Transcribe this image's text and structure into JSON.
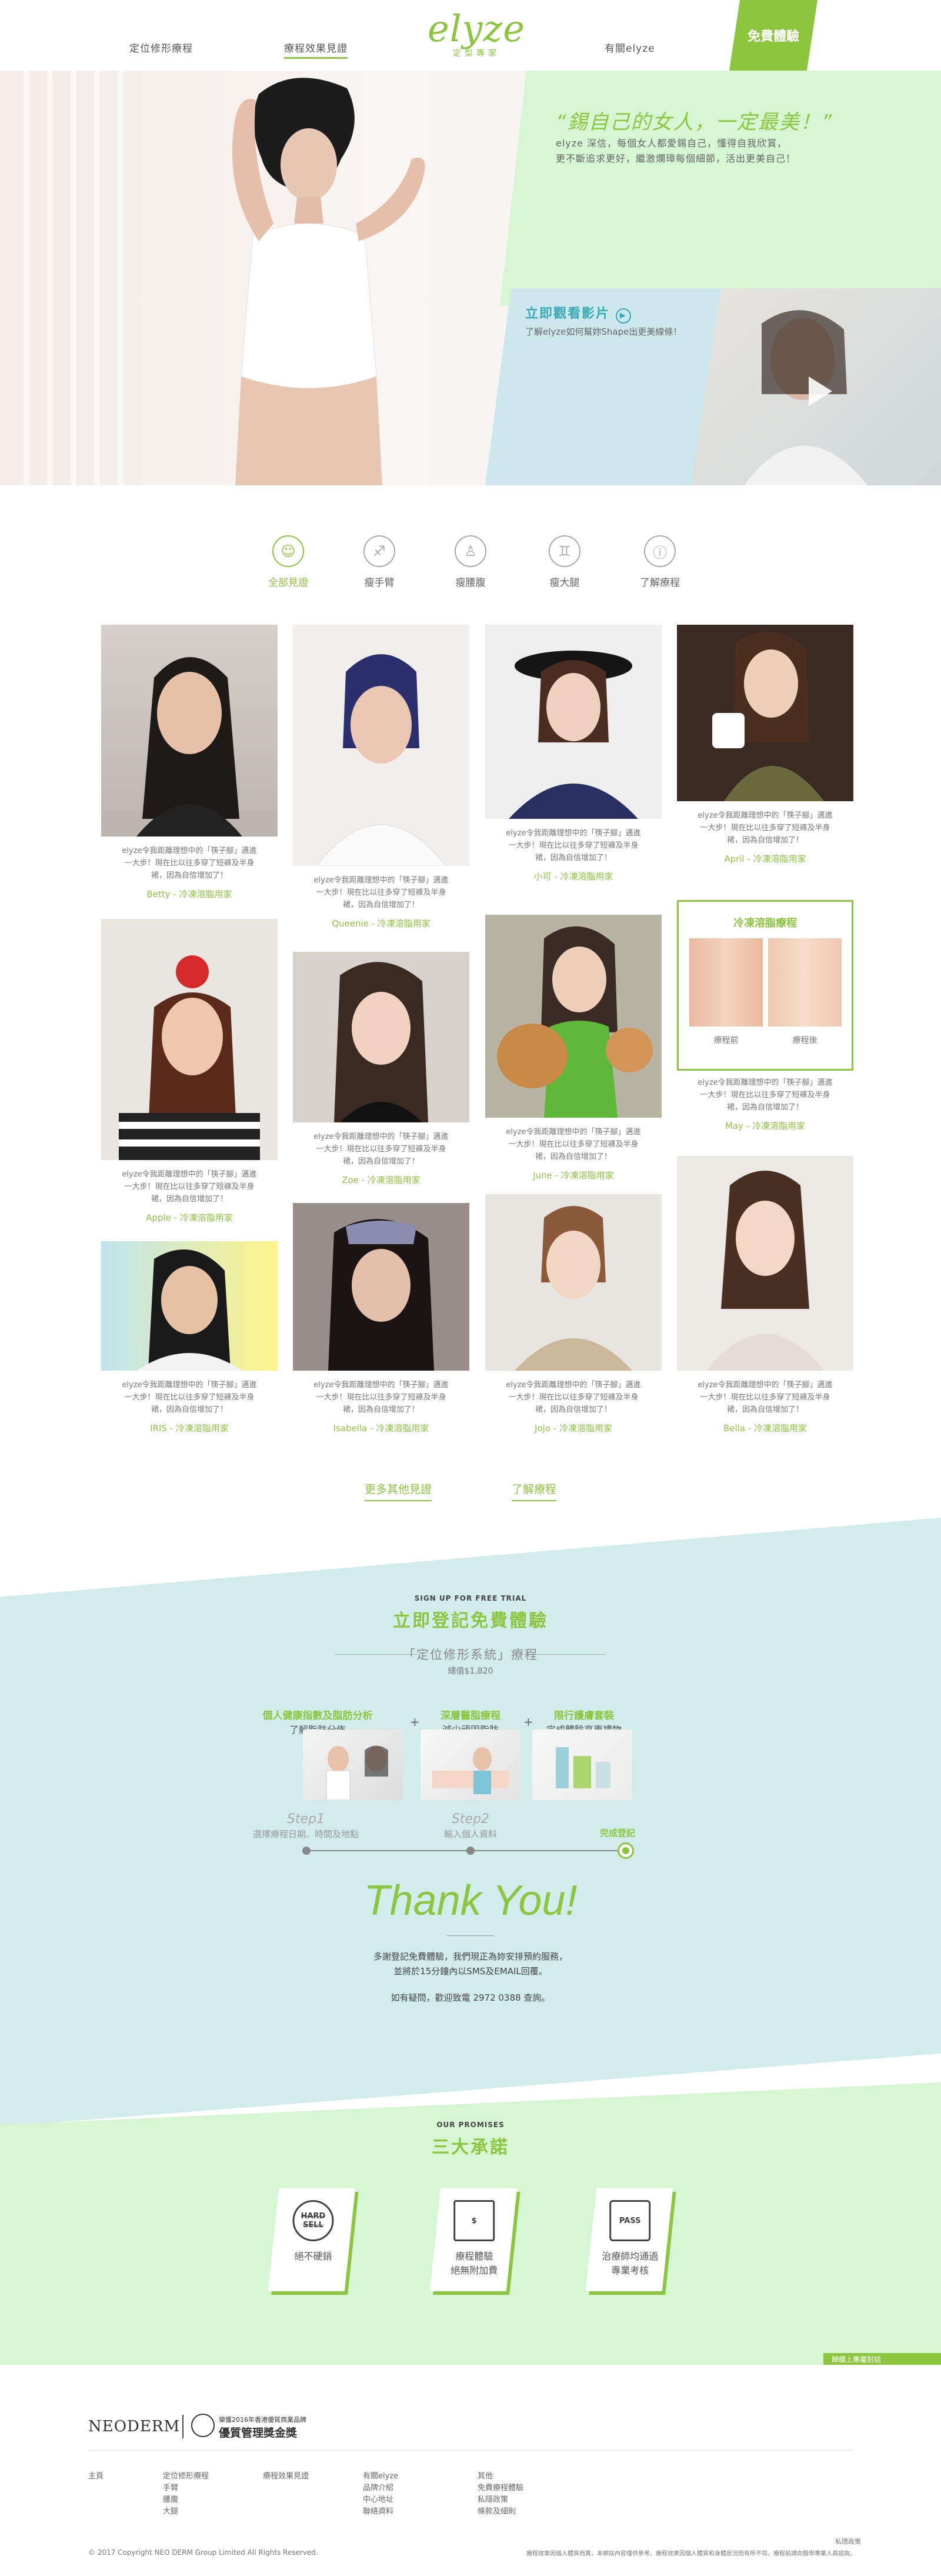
{
  "nav": {
    "left1": "定位修形療程",
    "left2": "療程效果見證",
    "right1": "有關elyze",
    "cta": "免費體驗"
  },
  "logo": {
    "word": "elyze",
    "sub": "定型專家"
  },
  "hero": {
    "quote": "“錫自己的女人，一定最美！”",
    "sub1": "elyze 深信，每個女人都愛錫自己，懂得自我欣賞，",
    "sub2": "更不斷追求更好，繼激爛璋每個細節，活出更美自己！",
    "video_title": "立即觀看影片",
    "video_sub": "了解elyze如何幫妳Shape出更美線條！"
  },
  "filters": [
    {
      "label": "全部見證",
      "icon": "body-icon"
    },
    {
      "label": "瘦手臂",
      "icon": "arm-icon"
    },
    {
      "label": "瘦腰腹",
      "icon": "waist-icon"
    },
    {
      "label": "瘦大腿",
      "icon": "thigh-icon"
    },
    {
      "label": "了解療程",
      "icon": "info-icon"
    }
  ],
  "cards": {
    "desc": "elyze令我距離理想中的「筷子腳」邁進一大步！現在比以往多穿了短褲及半身裙，因為自信增加了！",
    "betty": "Betty - 冷凍溶脂用家",
    "queenie": "Queenie - 冷凍溶脂用家",
    "xiaoke": "小可 - 冷凍溶脂用家",
    "april": "April - 冷凍溶脂用家",
    "apple": "Apple - 冷凍溶脂用家",
    "zoe": "Zoe - 冷凍溶脂用家",
    "june": "June - 冷凍溶脂用家",
    "may": "May - 冷凍溶脂用家",
    "iris": "IRIS - 冷凍溶脂用家",
    "isabella": "Isabella - 冷凍溶脂用家",
    "jojo": "Jojo - 冷凍溶脂用家",
    "bella": "Bella - 冷凍溶脂用家"
  },
  "ba": {
    "title": "冷凍溶脂療程",
    "before": "療程前",
    "after": "療程後"
  },
  "links": {
    "more": "更多其他見證",
    "learn": "了解療程"
  },
  "signup": {
    "eyebrow": "SIGN UP FOR FREE TRIAL",
    "title": "立即登記免費體驗",
    "system": "「定位修形系統」療程",
    "value": "總值$1,820",
    "s1a": "個人健康指數及脂肪分析",
    "s1b": "了解脂肪分佈",
    "s2a": "深層醫脂療程",
    "s2b": "減少頑固脂肪",
    "s3a": "限行護膚套裝",
    "s3b": "完成體驗享專禮物",
    "step1": "Step1",
    "step1s": "選擇療程日期、時間及地點",
    "step2": "Step2",
    "step2s": "輸入個人資料",
    "step3": "完成登記",
    "thanks": "Thank You!",
    "msg1": "多謝登記免費體驗，我們現正為妳安排預約服務，",
    "msg2": "並將於15分鐘內以SMS及EMAIL回覆。",
    "phone": "如有疑問，歡迎致電 2972 0388 查詢。"
  },
  "promises": {
    "eyebrow": "OUR PROMISES",
    "title": "三大承諾",
    "p1": "絕不硬銷",
    "p1icon": "HARD SELL",
    "p2a": "療程體驗",
    "p2b": "絕無附加費",
    "p3a": "治療師均通過",
    "p3b": "專業考核",
    "p3icon": "PASS"
  },
  "float_btn": "歸續上專屬對話",
  "footer": {
    "brand": "NEODERM",
    "award1": "榮獲2016年香港優質商業品牌",
    "award2": "優質管理獎金獎",
    "c1": "主頁",
    "c2": [
      "定位修形療程",
      "手臂",
      "腰腹",
      "大腿"
    ],
    "c3": "療程效果見證",
    "c4": [
      "有關elyze",
      "品牌介紹",
      "中心地址",
      "聯絡資料"
    ],
    "c5": [
      "其他",
      "免費療程體驗",
      "私隱政策",
      "條款及細則"
    ],
    "copyright": "© 2017 Copyright NEO DERM Group Limited All Rights Reserved.",
    "privacy": "私隱政策",
    "disclaimer": "療程效果因個人體質而異，本網站內容僅供參考。療程效果因個人體質和身體狀況而有所不同，療程前請向醫學專業人員諮詢。"
  },
  "colors": {
    "accent": "#8cc63f",
    "teal": "#3aa9b6",
    "mint": "#d6f5d3"
  }
}
